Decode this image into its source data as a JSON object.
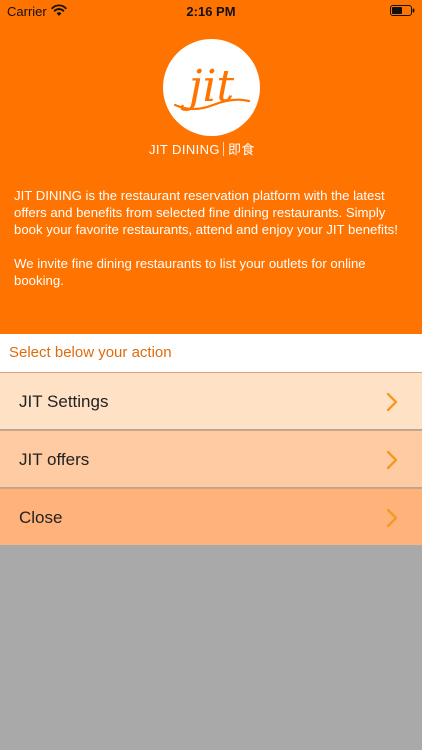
{
  "status_bar": {
    "carrier": "Carrier",
    "time": "2:16 PM",
    "icons": [
      "wifi-icon",
      "battery-icon"
    ]
  },
  "header": {
    "logo_text": "jit",
    "brand_name": "JIT DINING",
    "brand_chinese": "即食",
    "description_1": "JIT DINING is the restaurant reservation platform with the latest offers and benefits from selected fine dining restaurants. Simply book your favorite restaurants, attend and enjoy your JIT benefits!",
    "description_2": "We invite fine dining restaurants to list your outlets for online booking."
  },
  "action_section": {
    "title": "Select below your action"
  },
  "menu": {
    "items": [
      {
        "label": "JIT Settings",
        "icon": "chevron-right-icon"
      },
      {
        "label": "JIT offers",
        "icon": "chevron-right-icon"
      },
      {
        "label": "Close",
        "icon": "chevron-right-icon"
      }
    ]
  },
  "colors": {
    "accent": "#ff7300",
    "chevron": "#f39a24",
    "label_text": "#e06b0c",
    "background": "#a9a9a9"
  }
}
